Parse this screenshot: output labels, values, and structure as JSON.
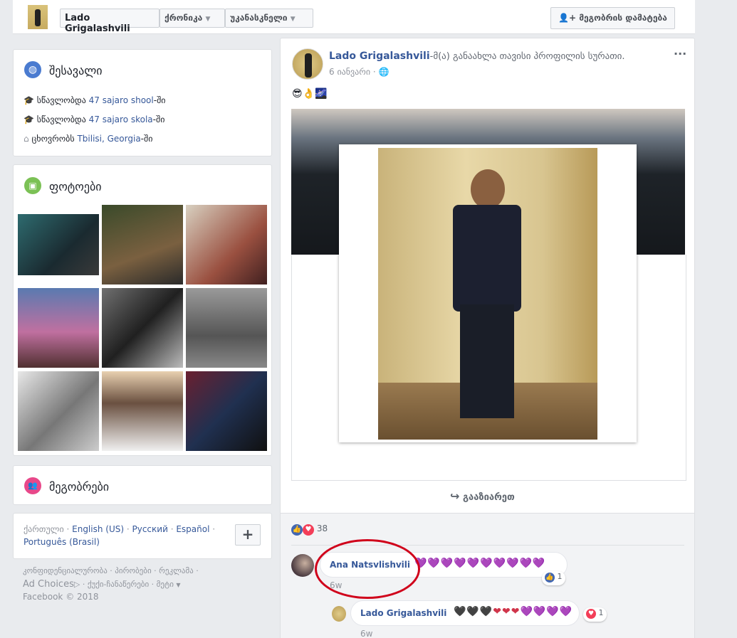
{
  "topbar": {
    "name": "Lado Grigalashvili",
    "timeline": "ქრონიკა",
    "recent": "უკანასკნელი",
    "add_friend": "მეგობრის დამატება"
  },
  "intro": {
    "title": "შესავალი",
    "items": [
      {
        "prefix": "სწავლობდა ",
        "link": "47 sajaro shool",
        "suffix": "-ში"
      },
      {
        "prefix": "სწავლობდა ",
        "link": "47 sajaro skola",
        "suffix": "-ში"
      },
      {
        "prefix": "ცხოვრობს ",
        "link": "Tbilisi, Georgia",
        "suffix": "-ში"
      }
    ]
  },
  "photos": {
    "title": "ფოტოები"
  },
  "friends": {
    "title": "მეგობრები"
  },
  "languages": {
    "line1": [
      "ქართული",
      "English (US)",
      "Русский",
      "Español"
    ],
    "line2": "Português (Brasil)",
    "plus": "+"
  },
  "footer": {
    "line1": "კონფიდენციალურობა · პირობები · რეკლამა ·",
    "ad_choices": "Ad Choices",
    "line2_rest": " · ქუქი-ჩანაწერები · მეტი",
    "copyright": "Facebook © 2018"
  },
  "post": {
    "author": "Lado Grigalashvili",
    "action": "-მ(ა) განაახლა თავისი პროფილის სურათი.",
    "date": "6 იანვარი",
    "separator": "·",
    "emoji": "😎👌🌌",
    "more": "···",
    "share": "გააზიარეთ",
    "reaction_count": "38"
  },
  "comments": [
    {
      "author": "Ana Natsvlishvili",
      "hearts": "💜💜💜💜💜💜💜💜💜💜",
      "time": "6w",
      "likes": "1"
    },
    {
      "author": "Lado Grigalashvili",
      "hearts": "🖤🖤🖤❤❤❤💜💜💜💜",
      "time": "6w",
      "likes": "1"
    }
  ],
  "colors": {
    "link": "#365899",
    "annotation": "#d0021b",
    "bg": "#e9ebee"
  }
}
